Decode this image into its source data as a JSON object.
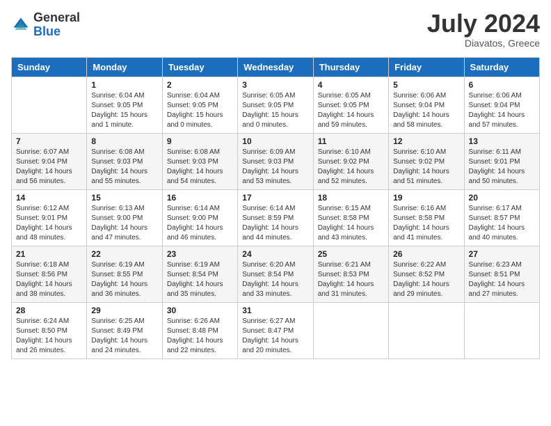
{
  "header": {
    "logo": {
      "general": "General",
      "blue": "Blue"
    },
    "title": "July 2024",
    "location": "Diavatos, Greece"
  },
  "weekdays": [
    "Sunday",
    "Monday",
    "Tuesday",
    "Wednesday",
    "Thursday",
    "Friday",
    "Saturday"
  ],
  "weeks": [
    [
      {
        "day": "",
        "sunrise": "",
        "sunset": "",
        "daylight": ""
      },
      {
        "day": "1",
        "sunrise": "Sunrise: 6:04 AM",
        "sunset": "Sunset: 9:05 PM",
        "daylight": "Daylight: 15 hours and 1 minute."
      },
      {
        "day": "2",
        "sunrise": "Sunrise: 6:04 AM",
        "sunset": "Sunset: 9:05 PM",
        "daylight": "Daylight: 15 hours and 0 minutes."
      },
      {
        "day": "3",
        "sunrise": "Sunrise: 6:05 AM",
        "sunset": "Sunset: 9:05 PM",
        "daylight": "Daylight: 15 hours and 0 minutes."
      },
      {
        "day": "4",
        "sunrise": "Sunrise: 6:05 AM",
        "sunset": "Sunset: 9:05 PM",
        "daylight": "Daylight: 14 hours and 59 minutes."
      },
      {
        "day": "5",
        "sunrise": "Sunrise: 6:06 AM",
        "sunset": "Sunset: 9:04 PM",
        "daylight": "Daylight: 14 hours and 58 minutes."
      },
      {
        "day": "6",
        "sunrise": "Sunrise: 6:06 AM",
        "sunset": "Sunset: 9:04 PM",
        "daylight": "Daylight: 14 hours and 57 minutes."
      }
    ],
    [
      {
        "day": "7",
        "sunrise": "Sunrise: 6:07 AM",
        "sunset": "Sunset: 9:04 PM",
        "daylight": "Daylight: 14 hours and 56 minutes."
      },
      {
        "day": "8",
        "sunrise": "Sunrise: 6:08 AM",
        "sunset": "Sunset: 9:03 PM",
        "daylight": "Daylight: 14 hours and 55 minutes."
      },
      {
        "day": "9",
        "sunrise": "Sunrise: 6:08 AM",
        "sunset": "Sunset: 9:03 PM",
        "daylight": "Daylight: 14 hours and 54 minutes."
      },
      {
        "day": "10",
        "sunrise": "Sunrise: 6:09 AM",
        "sunset": "Sunset: 9:03 PM",
        "daylight": "Daylight: 14 hours and 53 minutes."
      },
      {
        "day": "11",
        "sunrise": "Sunrise: 6:10 AM",
        "sunset": "Sunset: 9:02 PM",
        "daylight": "Daylight: 14 hours and 52 minutes."
      },
      {
        "day": "12",
        "sunrise": "Sunrise: 6:10 AM",
        "sunset": "Sunset: 9:02 PM",
        "daylight": "Daylight: 14 hours and 51 minutes."
      },
      {
        "day": "13",
        "sunrise": "Sunrise: 6:11 AM",
        "sunset": "Sunset: 9:01 PM",
        "daylight": "Daylight: 14 hours and 50 minutes."
      }
    ],
    [
      {
        "day": "14",
        "sunrise": "Sunrise: 6:12 AM",
        "sunset": "Sunset: 9:01 PM",
        "daylight": "Daylight: 14 hours and 48 minutes."
      },
      {
        "day": "15",
        "sunrise": "Sunrise: 6:13 AM",
        "sunset": "Sunset: 9:00 PM",
        "daylight": "Daylight: 14 hours and 47 minutes."
      },
      {
        "day": "16",
        "sunrise": "Sunrise: 6:14 AM",
        "sunset": "Sunset: 9:00 PM",
        "daylight": "Daylight: 14 hours and 46 minutes."
      },
      {
        "day": "17",
        "sunrise": "Sunrise: 6:14 AM",
        "sunset": "Sunset: 8:59 PM",
        "daylight": "Daylight: 14 hours and 44 minutes."
      },
      {
        "day": "18",
        "sunrise": "Sunrise: 6:15 AM",
        "sunset": "Sunset: 8:58 PM",
        "daylight": "Daylight: 14 hours and 43 minutes."
      },
      {
        "day": "19",
        "sunrise": "Sunrise: 6:16 AM",
        "sunset": "Sunset: 8:58 PM",
        "daylight": "Daylight: 14 hours and 41 minutes."
      },
      {
        "day": "20",
        "sunrise": "Sunrise: 6:17 AM",
        "sunset": "Sunset: 8:57 PM",
        "daylight": "Daylight: 14 hours and 40 minutes."
      }
    ],
    [
      {
        "day": "21",
        "sunrise": "Sunrise: 6:18 AM",
        "sunset": "Sunset: 8:56 PM",
        "daylight": "Daylight: 14 hours and 38 minutes."
      },
      {
        "day": "22",
        "sunrise": "Sunrise: 6:19 AM",
        "sunset": "Sunset: 8:55 PM",
        "daylight": "Daylight: 14 hours and 36 minutes."
      },
      {
        "day": "23",
        "sunrise": "Sunrise: 6:19 AM",
        "sunset": "Sunset: 8:54 PM",
        "daylight": "Daylight: 14 hours and 35 minutes."
      },
      {
        "day": "24",
        "sunrise": "Sunrise: 6:20 AM",
        "sunset": "Sunset: 8:54 PM",
        "daylight": "Daylight: 14 hours and 33 minutes."
      },
      {
        "day": "25",
        "sunrise": "Sunrise: 6:21 AM",
        "sunset": "Sunset: 8:53 PM",
        "daylight": "Daylight: 14 hours and 31 minutes."
      },
      {
        "day": "26",
        "sunrise": "Sunrise: 6:22 AM",
        "sunset": "Sunset: 8:52 PM",
        "daylight": "Daylight: 14 hours and 29 minutes."
      },
      {
        "day": "27",
        "sunrise": "Sunrise: 6:23 AM",
        "sunset": "Sunset: 8:51 PM",
        "daylight": "Daylight: 14 hours and 27 minutes."
      }
    ],
    [
      {
        "day": "28",
        "sunrise": "Sunrise: 6:24 AM",
        "sunset": "Sunset: 8:50 PM",
        "daylight": "Daylight: 14 hours and 26 minutes."
      },
      {
        "day": "29",
        "sunrise": "Sunrise: 6:25 AM",
        "sunset": "Sunset: 8:49 PM",
        "daylight": "Daylight: 14 hours and 24 minutes."
      },
      {
        "day": "30",
        "sunrise": "Sunrise: 6:26 AM",
        "sunset": "Sunset: 8:48 PM",
        "daylight": "Daylight: 14 hours and 22 minutes."
      },
      {
        "day": "31",
        "sunrise": "Sunrise: 6:27 AM",
        "sunset": "Sunset: 8:47 PM",
        "daylight": "Daylight: 14 hours and 20 minutes."
      },
      {
        "day": "",
        "sunrise": "",
        "sunset": "",
        "daylight": ""
      },
      {
        "day": "",
        "sunrise": "",
        "sunset": "",
        "daylight": ""
      },
      {
        "day": "",
        "sunrise": "",
        "sunset": "",
        "daylight": ""
      }
    ]
  ]
}
